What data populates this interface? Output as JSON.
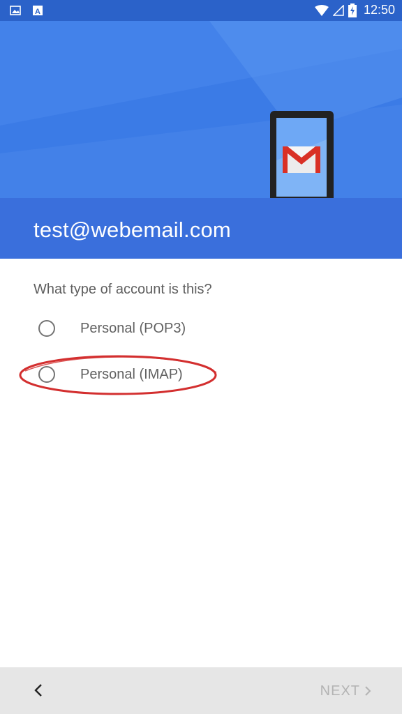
{
  "status_bar": {
    "time": "12:50",
    "icons": [
      "image-notification-icon",
      "text-notification-icon",
      "wifi-icon",
      "signal-icon",
      "battery-charging-icon"
    ]
  },
  "header": {
    "email": "test@webemail.com",
    "illustration": "phone-with-gmail-logo"
  },
  "form": {
    "question": "What type of account is this?",
    "options": [
      {
        "label": "Personal (POP3)",
        "selected": false
      },
      {
        "label": "Personal (IMAP)",
        "selected": false,
        "highlighted": true
      }
    ]
  },
  "footer": {
    "back_icon": "chevron-left-icon",
    "next_label": "NEXT",
    "next_enabled": false
  },
  "colors": {
    "header_blue": "#3b7be6",
    "header_band": "#3a6fdc",
    "annotation_red": "#d32f2f",
    "disabled_text": "#b3b3b3"
  }
}
